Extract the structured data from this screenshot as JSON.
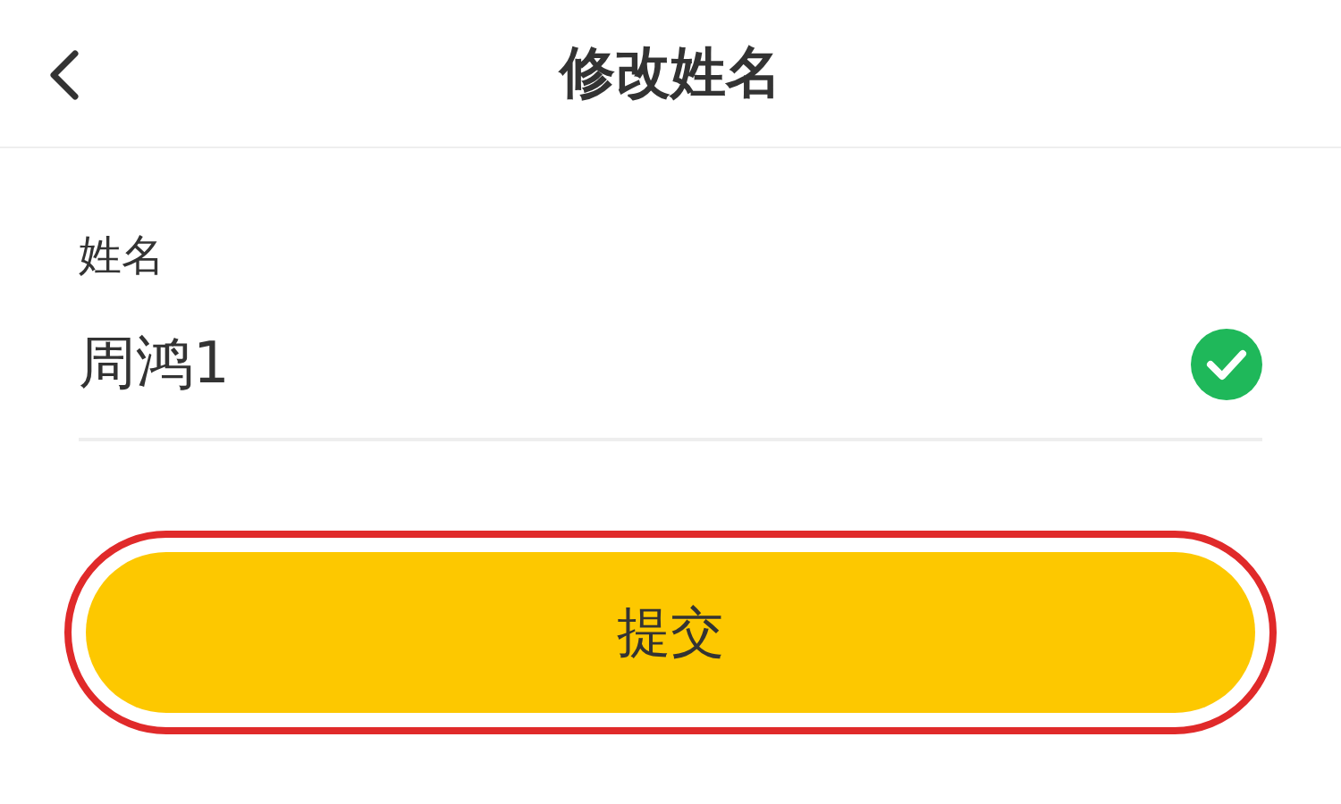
{
  "header": {
    "title": "修改姓名"
  },
  "field": {
    "label": "姓名",
    "value": "周鸿1",
    "valid": true
  },
  "submit_button": {
    "label": "提交",
    "highlighted": true
  }
}
